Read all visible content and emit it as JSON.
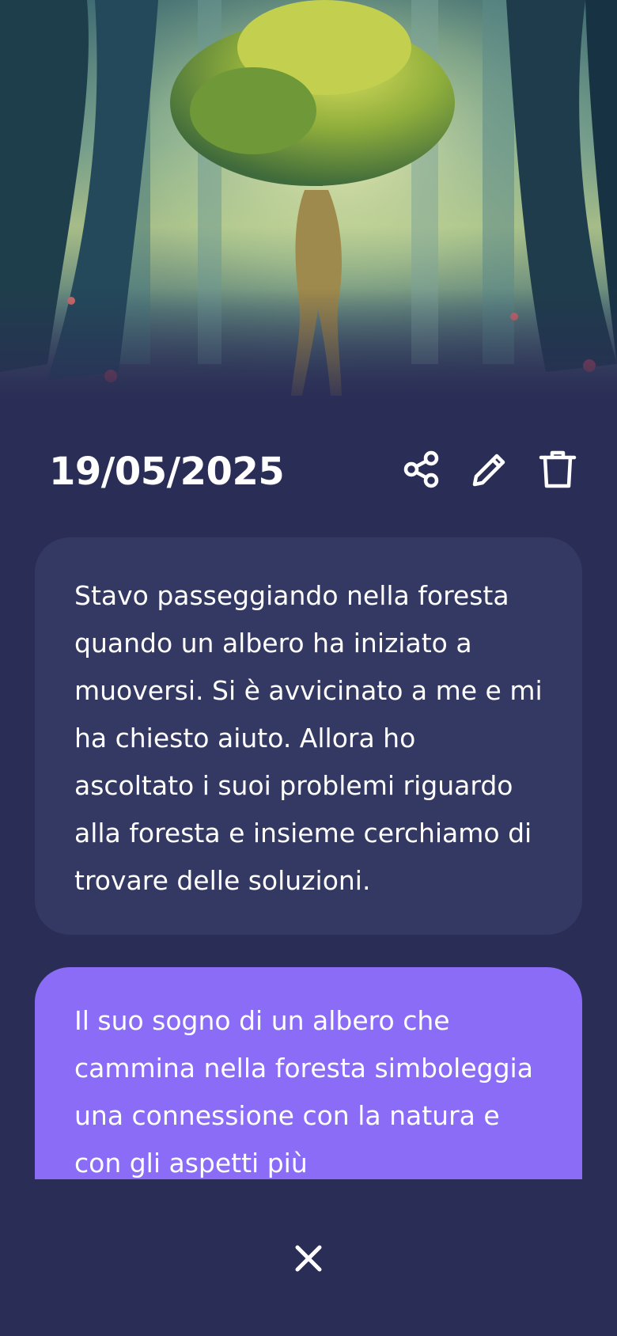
{
  "entry": {
    "date": "19/05/2025",
    "dream_text": "Stavo passeggiando nella foresta quando un albero ha iniziato a muoversi. Si è avvicinato a me e mi ha chiesto aiuto. Allora ho ascoltato i suoi problemi riguardo alla foresta e insieme cerchiamo di trovare delle soluzioni.",
    "interpretation_text": "Il suo sogno di un albero che cammina nella foresta simboleggia una connessione con la natura e con gli aspetti più"
  },
  "actions": {
    "share_icon": "share-icon",
    "edit_icon": "pencil-icon",
    "delete_icon": "trash-icon",
    "close_icon": "close-icon"
  },
  "colors": {
    "background": "#2a2d55",
    "dream_card": "#343963",
    "interpretation_card": "#8b6cf7",
    "text": "#ffffff"
  }
}
